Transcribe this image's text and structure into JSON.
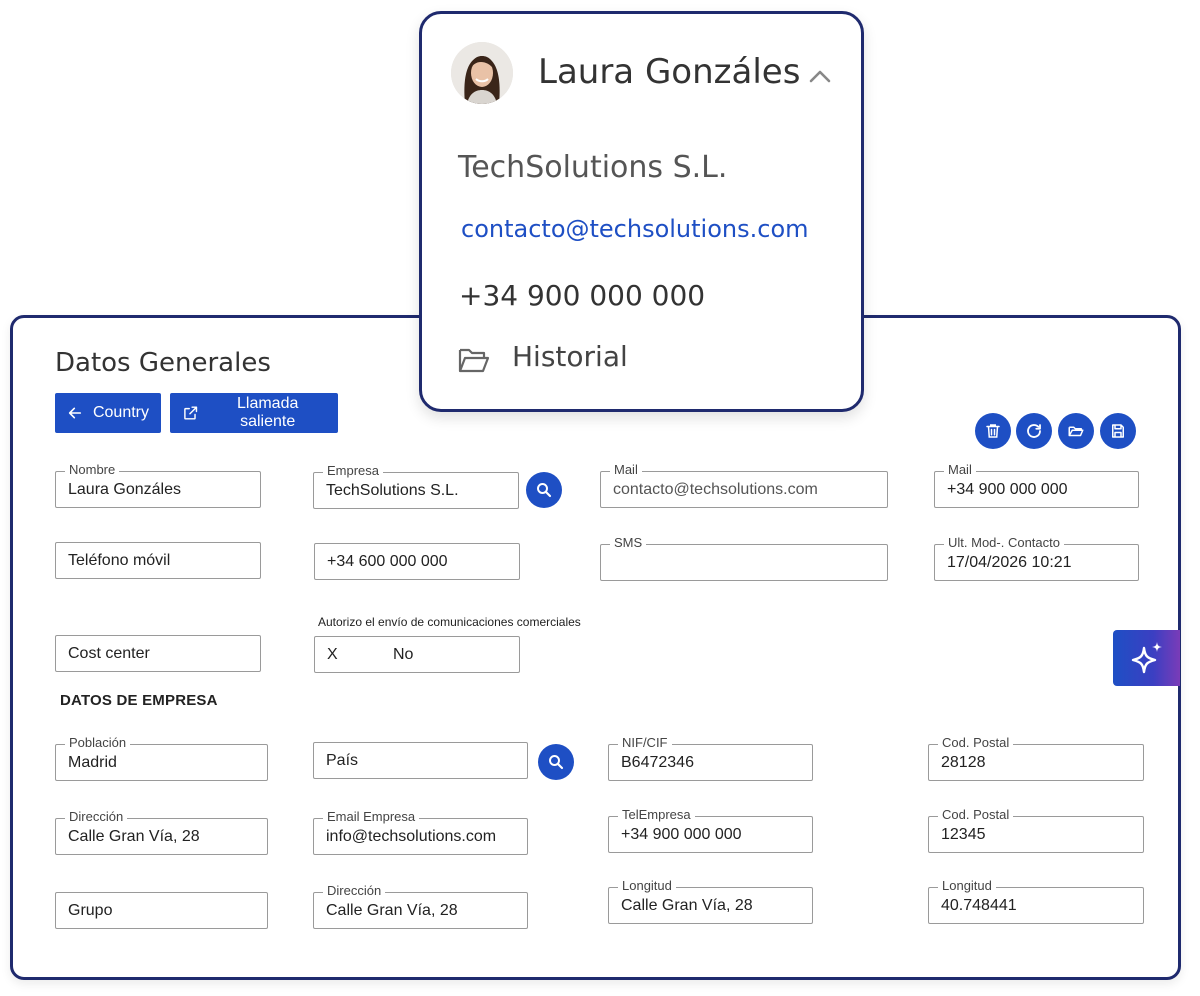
{
  "panel": {
    "title": "Datos Generales",
    "buttons": {
      "country": "Country",
      "call": "Llamada saliente"
    },
    "toolbar_icons": [
      "trash-icon",
      "refresh-icon",
      "folder-open-icon",
      "save-icon"
    ],
    "contact": {
      "nombre": {
        "label": "Nombre",
        "value": "Laura Gonzáles"
      },
      "empresa": {
        "label": "Empresa",
        "value": "TechSolutions S.L."
      },
      "mail": {
        "label": "Mail",
        "value": "contacto@techsolutions.com"
      },
      "mail2": {
        "label": "Mail",
        "value": "+34 900 000 000"
      },
      "movil": {
        "placeholder": "Teléfono móvil"
      },
      "telefono": {
        "value": "+34 600 000 000"
      },
      "sms": {
        "label": "SMS",
        "value": ""
      },
      "ult_mod": {
        "label": "Ult. Mod-. Contacto",
        "value": "17/04/2026 10:21"
      },
      "cost_center": {
        "placeholder": "Cost center"
      },
      "autorizo": {
        "label": "Autorizo el envío de comunicaciones comerciales",
        "x": "X",
        "value": "No"
      }
    },
    "section_empresa": "DATOS DE EMPRESA",
    "empresa": {
      "poblacion": {
        "label": "Población",
        "value": "Madrid"
      },
      "pais": {
        "placeholder": "País"
      },
      "nif": {
        "label": "NIF/CIF",
        "value": "B6472346"
      },
      "cod_postal1": {
        "label": "Cod. Postal",
        "value": "28128"
      },
      "direccion": {
        "label": "Dirección",
        "value": "Calle Gran Vía, 28"
      },
      "email_empresa": {
        "label": "Email Empresa",
        "value": "info@techsolutions.com"
      },
      "tel_empresa": {
        "label": "TelEmpresa",
        "value": "+34 900 000 000"
      },
      "cod_postal2": {
        "label": "Cod. Postal",
        "value": "12345"
      },
      "grupo": {
        "placeholder": "Grupo"
      },
      "direccion2": {
        "label": "Dirección",
        "value": "Calle Gran Vía, 28"
      },
      "longitud1": {
        "label": "Longitud",
        "value": "Calle Gran Vía, 28"
      },
      "longitud2": {
        "label": "Longitud",
        "value": "40.748441"
      }
    }
  },
  "card": {
    "name": "Laura Gonzáles",
    "company": "TechSolutions S.L.",
    "email": "contacto@techsolutions.com",
    "phone": "+34 900 000 000",
    "history": "Historial"
  },
  "colors": {
    "primary": "#1e4fc4",
    "border_dark": "#1f2a6e",
    "accent_purple": "#7a3cb8"
  }
}
